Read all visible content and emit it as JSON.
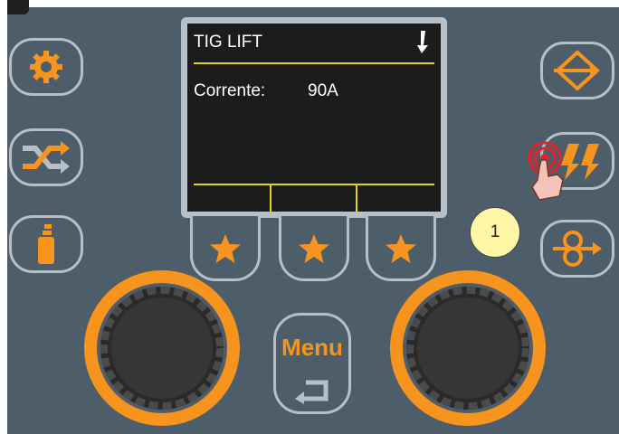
{
  "screen": {
    "title": "TIG LIFT",
    "param_label": "Corrente:",
    "param_value": "90A"
  },
  "left_buttons": [
    "gear-icon",
    "shuffle-icon",
    "torch-icon"
  ],
  "right_buttons": [
    "diamond-arrow-icon",
    "pulse-arrows-icon",
    "wire-feed-icon"
  ],
  "favorite_buttons": [
    "star-icon",
    "star-icon",
    "star-icon"
  ],
  "menu_button": {
    "label": "Menu"
  },
  "annotation": {
    "step": "1"
  },
  "colors": {
    "panel": "#4e5d6a",
    "accent_orange": "#f7941d",
    "lcd_background": "#1c1c1c",
    "lcd_lines": "#e6d21a",
    "button_border": "#b7bfc6",
    "badge": "#fff6a8"
  }
}
